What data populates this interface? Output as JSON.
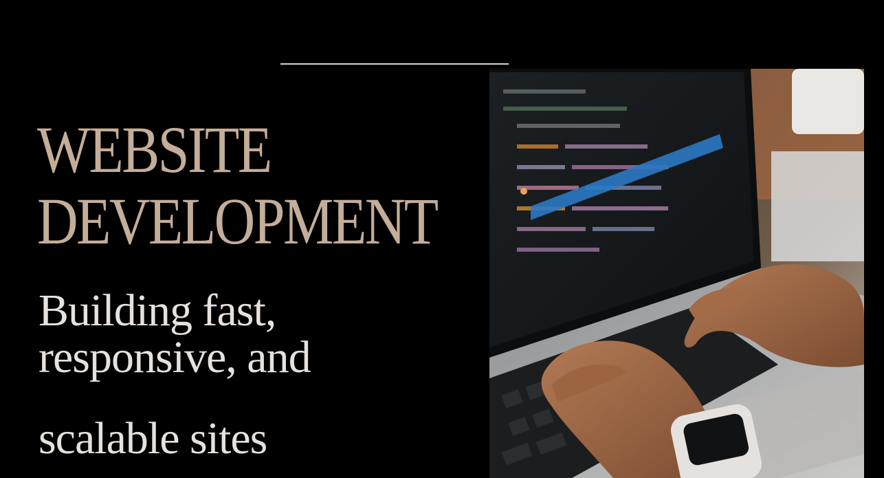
{
  "header": {
    "title_line1": "WEBSITE",
    "title_line2": "DEVELOPMENT"
  },
  "tagline": {
    "line1": "Building fast,",
    "line2": "responsive, and",
    "line3": "scalable sites"
  },
  "photo": {
    "subject": "hands-typing-on-laptop-with-code"
  },
  "colors": {
    "background": "#000000",
    "title": "#c4ad99",
    "tagline": "#e6e1dc",
    "divider": "#d9d4cf"
  }
}
